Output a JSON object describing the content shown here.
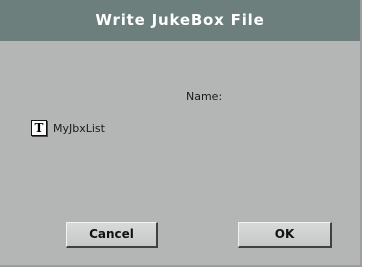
{
  "dialog": {
    "title": "Write JukeBox File",
    "name_label": "Name:",
    "name_value": "MyJbxList",
    "text_edit_icon_glyph": "T",
    "cancel_label": "Cancel",
    "ok_label": "OK"
  },
  "colors": {
    "title_bar": "#6c7f7c",
    "title_text": "#ffffff",
    "dialog_background": "#b4b6b6",
    "button_face": "#d0d2d2"
  },
  "icons": {
    "text_edit": "text-edit-icon"
  }
}
